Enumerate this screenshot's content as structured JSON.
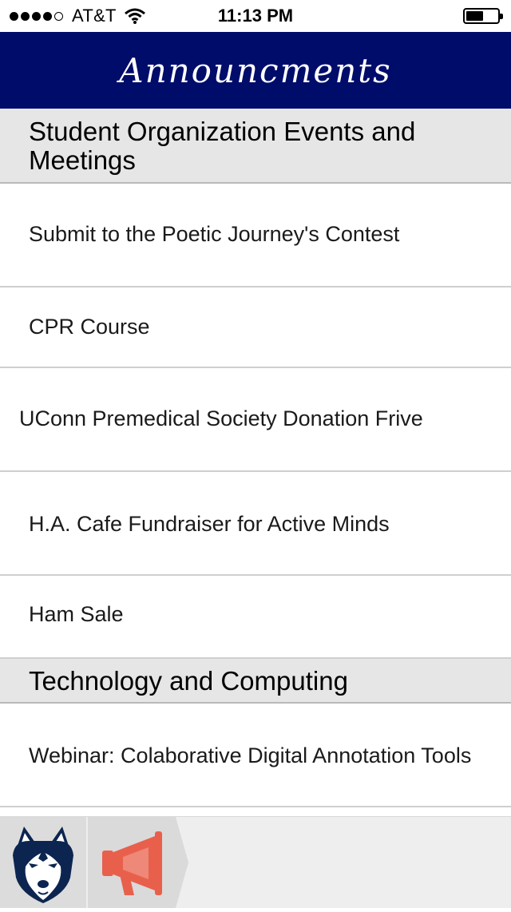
{
  "status_bar": {
    "carrier": "AT&T",
    "time": "11:13 PM",
    "signal_bars": 4,
    "signal_max": 5,
    "battery_level": 0.55,
    "icons": [
      "signal-dots-icon",
      "wifi-icon",
      "battery-icon"
    ]
  },
  "header": {
    "title": "Announcments",
    "background_color": "#000c6a"
  },
  "sections": [
    {
      "title": "Student Organization Events and Meetings",
      "items": [
        "Submit to the Poetic Journey's Contest",
        "CPR Course",
        "UConn Premedical Society Donation Frive",
        "H.A. Cafe Fundraiser for Active Minds",
        "Ham Sale"
      ]
    },
    {
      "title": "Technology and Computing",
      "items": [
        "Webinar: Colaborative Digital Annotation Tools"
      ]
    }
  ],
  "tab_bar": {
    "tabs": [
      {
        "icon": "husky-logo-icon",
        "selected": false
      },
      {
        "icon": "megaphone-icon",
        "selected": true
      }
    ],
    "accent_color": "#e8604c"
  }
}
